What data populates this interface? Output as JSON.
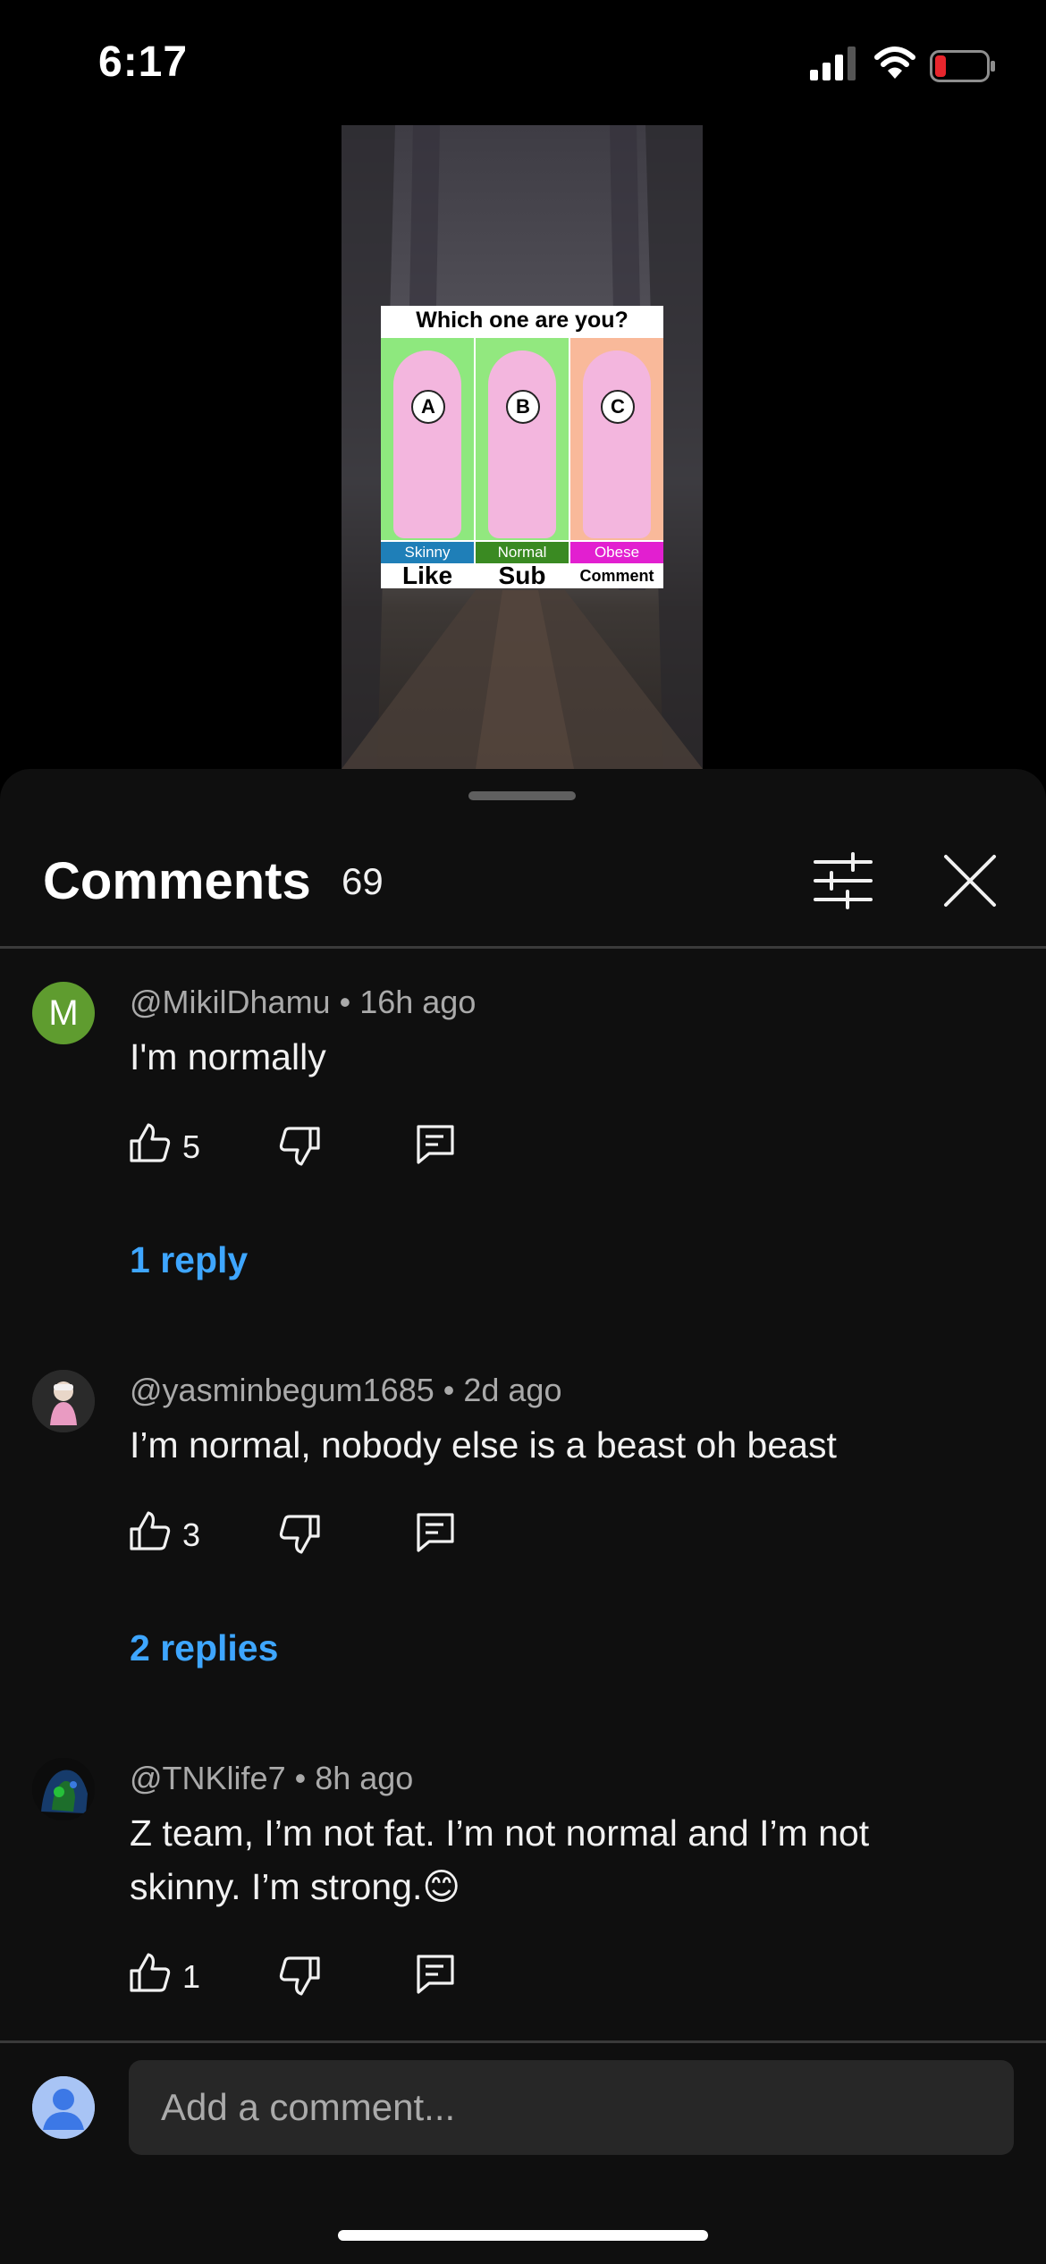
{
  "status": {
    "time": "6:17"
  },
  "video": {
    "quiz_title": "Which one are you?",
    "options": [
      {
        "letter": "A",
        "label": "Skinny",
        "action": "Like",
        "bg": "#8ee87e",
        "label_bg": "#1f7fb8"
      },
      {
        "letter": "B",
        "label": "Normal",
        "action": "Sub",
        "bg": "#92e87f",
        "label_bg": "#3a8a22"
      },
      {
        "letter": "C",
        "label": "Obese",
        "action": "Comment",
        "bg": "#f9b99a",
        "label_bg": "#e21fd0"
      }
    ]
  },
  "comments_header": {
    "title": "Comments",
    "count": "69"
  },
  "comments": [
    {
      "author": "@MikilDhamu",
      "time": "16h ago",
      "text": "I'm normally",
      "likes": "5",
      "replies": "1 reply",
      "avatar_letter": "M",
      "avatar_color": "#5f9c2f"
    },
    {
      "author": "@yasminbegum1685",
      "time": "2d ago",
      "text": "I’m normal, nobody else is a beast oh beast",
      "likes": "3",
      "replies": "2 replies"
    },
    {
      "author": "@TNKlife7",
      "time": "8h ago",
      "text": "Z team, I’m not fat. I’m not normal and I’m not skinny. I’m strong.😊",
      "likes": "1"
    }
  ],
  "composer": {
    "placeholder": "Add a comment..."
  },
  "colors": {
    "accent": "#3ea6ff",
    "sheet": "#0f0f0f"
  }
}
